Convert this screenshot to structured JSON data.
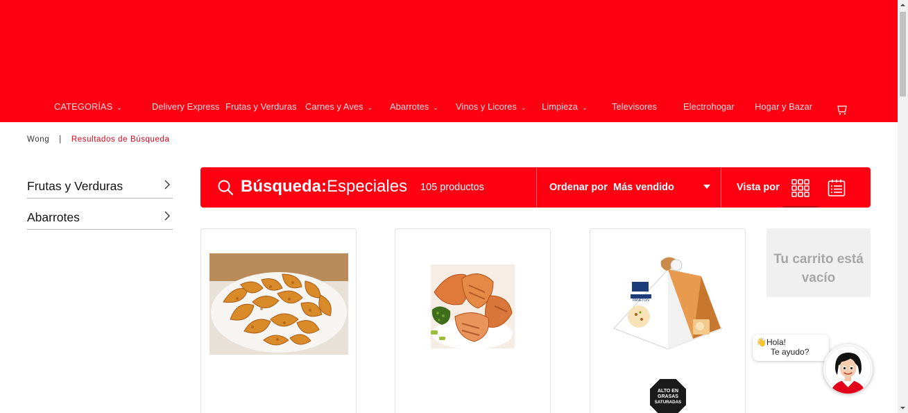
{
  "header": {
    "nav_items": [
      {
        "label": "CATEGORÍAS",
        "has_chevron": true
      },
      {
        "label": "Delivery Express",
        "has_chevron": false
      },
      {
        "label": "Frutas y Verduras",
        "has_chevron": false
      },
      {
        "label": "Carnes y Aves",
        "has_chevron": true
      },
      {
        "label": "Abarrotes",
        "has_chevron": true
      },
      {
        "label": "Vinos y Licores",
        "has_chevron": true
      },
      {
        "label": "Limpieza",
        "has_chevron": true
      },
      {
        "label": "Televisores",
        "has_chevron": true
      },
      {
        "label": "Electrohogar",
        "has_chevron": false
      },
      {
        "label": "Hogar y Bazar",
        "has_chevron": false
      }
    ]
  },
  "breadcrumb": {
    "home": "Wong",
    "separator": "|",
    "current": "Resultados de Búsqueda"
  },
  "sidebar": {
    "items": [
      {
        "label": "Frutas y Verduras"
      },
      {
        "label": "Abarrotes"
      }
    ]
  },
  "search_bar": {
    "label": "Búsqueda:",
    "term": "Especiales",
    "count": "105 productos",
    "sort_label": "Ordenar por",
    "sort_value": "Más vendido",
    "view_label": "Vista por"
  },
  "products": [
    {
      "image": "papas-gajo-image"
    },
    {
      "image": "pollo-chimichurri-image"
    },
    {
      "image": "panetón-blanca-flor-image",
      "warning_seal": [
        "ALTO EN",
        "GRASAS",
        "SATURADAS"
      ]
    }
  ],
  "cart": {
    "empty_message": "Tu carrito está vacío"
  },
  "chat": {
    "greeting_emoji": "👋",
    "greeting": "Hola!",
    "prompt": "Te ayudo?"
  },
  "colors": {
    "brand_red": "#ff0013",
    "breadcrumb_active": "#e2001a",
    "cart_empty_bg": "#f0f0f0"
  }
}
